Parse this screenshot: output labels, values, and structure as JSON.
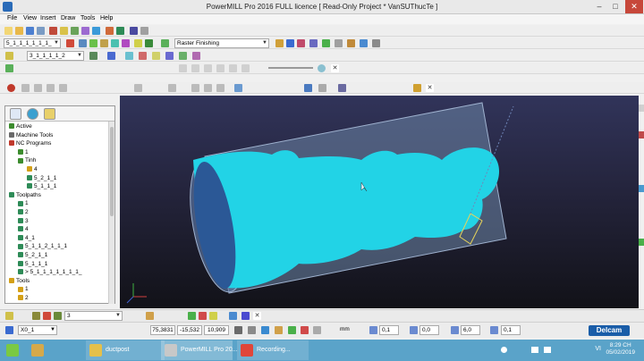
{
  "window": {
    "title": "PowerMILL Pro 2016 FULL licence    [ Read-Only Project * VanSUThucTe ]"
  },
  "menu": [
    "File",
    "View",
    "Insert",
    "Draw",
    "Tools",
    "Help"
  ],
  "toolbars": {
    "toolpath_combo": "5_1_1_1_1_1_1_",
    "strategy_combo": "Raster Finishing",
    "tool_combo": "3_1_1_1_1_2"
  },
  "explorer": {
    "items": [
      {
        "label": "Active",
        "color": "#3c8c2e"
      },
      {
        "label": "Machine Tools",
        "color": "#6a6a6a"
      },
      {
        "label": "NC Programs",
        "color": "#c0392b"
      },
      {
        "label": "1",
        "color": "#3c8c2e"
      },
      {
        "label": "Tinh",
        "color": "#3c8c2e"
      },
      {
        "label": "4",
        "color": "#d4a017"
      },
      {
        "label": "5_2_1_1",
        "color": "#2e8b57"
      },
      {
        "label": "5_1_1_1",
        "color": "#2e8b57"
      },
      {
        "label": "Toolpaths",
        "color": "#2e8b57"
      },
      {
        "label": "1",
        "color": "#2e8b57"
      },
      {
        "label": "2",
        "color": "#2e8b57"
      },
      {
        "label": "3",
        "color": "#2e8b57"
      },
      {
        "label": "4",
        "color": "#2e8b57"
      },
      {
        "label": "4_1",
        "color": "#2e8b57"
      },
      {
        "label": "5_1_1_2_1_1_1",
        "color": "#2e8b57"
      },
      {
        "label": "5_2_1_1",
        "color": "#2e8b57"
      },
      {
        "label": "5_1_1_1",
        "color": "#2e8b57"
      },
      {
        "label": "> 5_1_1_1_1_1_1_1_",
        "color": "#2e8b57"
      },
      {
        "label": "Tools",
        "color": "#d4a017"
      },
      {
        "label": "1",
        "color": "#d4a017"
      },
      {
        "label": "2",
        "color": "#d4a017"
      }
    ]
  },
  "bottom_toolbar": {
    "value_combo": "3"
  },
  "status": {
    "workplane": "X0_1",
    "x": "75,3831",
    "y": "-15,532",
    "z": "10,909",
    "units": "mm",
    "tol1": "0,1",
    "tol2": "0,0",
    "tol3": "6,0",
    "tol4": "0,1",
    "brand": "Delcam"
  },
  "taskbar": {
    "items": [
      {
        "label": "",
        "color": "#7ac943"
      },
      {
        "label": "",
        "color": "#d6a94a"
      },
      {
        "label": "ductpost",
        "color": "#e5c04a"
      },
      {
        "label": "PowerMILL Pro 20...",
        "color": "#c8c8c8"
      },
      {
        "label": "Recording...",
        "color": "#e0463a"
      }
    ],
    "lang": "VI",
    "time": "8:29 CH",
    "date": "05/02/2019"
  },
  "model": {
    "part_color": "#22d3e6",
    "stock_color": "#8aa3c2"
  }
}
